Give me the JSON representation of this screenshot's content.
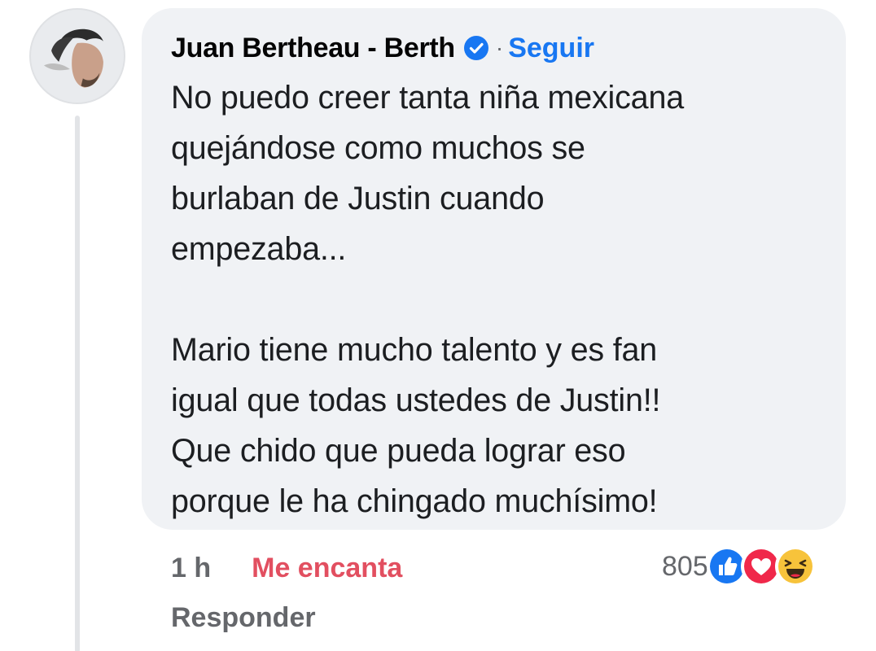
{
  "comment": {
    "author": "Juan Bertheau - Berth",
    "separator": "·",
    "follow_label": "Seguir",
    "text": "No puedo creer tanta niña mexicana\nquejándose como muchos se\nburlaban de Justin cuando\nempezaba...\n\nMario tiene mucho talento y es fan\nigual que todas ustedes de Justin!!\nQue chido que pueda lograr eso\nporque le ha chingado muchísimo!"
  },
  "meta": {
    "time": "1 h",
    "reaction_label": "Me encanta",
    "reply_label": "Responder"
  },
  "reactions": {
    "count": "805",
    "icons": [
      "like-icon",
      "love-icon",
      "haha-icon"
    ]
  },
  "colors": {
    "bubble": "#f0f2f5",
    "link": "#1877f2",
    "love": "#e24f60",
    "muted": "#65676b"
  }
}
